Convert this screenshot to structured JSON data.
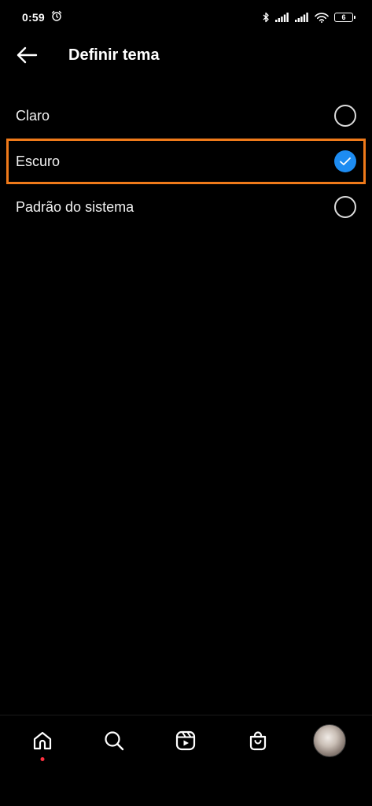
{
  "status_bar": {
    "time": "0:59",
    "battery_level": "6",
    "icons": [
      "alarm-icon",
      "bluetooth-icon",
      "signal-icon",
      "signal-icon",
      "wifi-icon",
      "battery-icon"
    ]
  },
  "header": {
    "title": "Definir tema",
    "back_icon": "arrow-left-icon"
  },
  "options": [
    {
      "label": "Claro",
      "selected": false
    },
    {
      "label": "Escuro",
      "selected": true
    },
    {
      "label": "Padrão do sistema",
      "selected": false
    }
  ],
  "bottom_nav": {
    "items": [
      "home-icon",
      "search-icon",
      "reels-icon",
      "shop-icon",
      "profile-avatar"
    ],
    "active": "home-icon"
  },
  "colors": {
    "background": "#000000",
    "accent": "#1d8cf2",
    "highlight_outline": "#ef7a1a",
    "notification_dot": "#ff3040"
  }
}
